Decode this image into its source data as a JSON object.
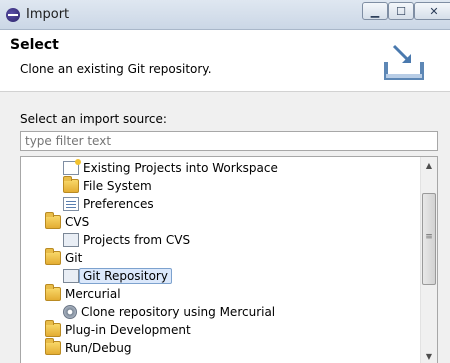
{
  "window": {
    "title": "Import",
    "controls": {
      "minimize": "▁",
      "maximize": "☐",
      "close": "✕"
    }
  },
  "header": {
    "title": "Select",
    "description": "Clone an existing Git repository."
  },
  "import": {
    "label": "Select an import source:",
    "filter_placeholder": "type filter text"
  },
  "tree": {
    "items": [
      {
        "label": "Existing Projects into Workspace",
        "icon": "project-icon",
        "level": 2
      },
      {
        "label": "File System",
        "icon": "folder-icon",
        "level": 2
      },
      {
        "label": "Preferences",
        "icon": "document-icon",
        "level": 2
      },
      {
        "label": "CVS",
        "icon": "folder-icon",
        "level": 1
      },
      {
        "label": "Projects from CVS",
        "icon": "cvs-icon",
        "level": 2
      },
      {
        "label": "Git",
        "icon": "folder-icon",
        "level": 1
      },
      {
        "label": "Git Repository",
        "icon": "git-icon",
        "level": 2,
        "selected": true
      },
      {
        "label": "Mercurial",
        "icon": "folder-icon",
        "level": 1
      },
      {
        "label": "Clone repository using Mercurial",
        "icon": "gear-icon",
        "level": 2
      },
      {
        "label": "Plug-in Development",
        "icon": "folder-icon",
        "level": 1
      },
      {
        "label": "Run/Debug",
        "icon": "folder-icon",
        "level": 1
      }
    ]
  },
  "colors": {
    "selection_bg": "#dbe8fb",
    "selection_border": "#7da2ce"
  }
}
